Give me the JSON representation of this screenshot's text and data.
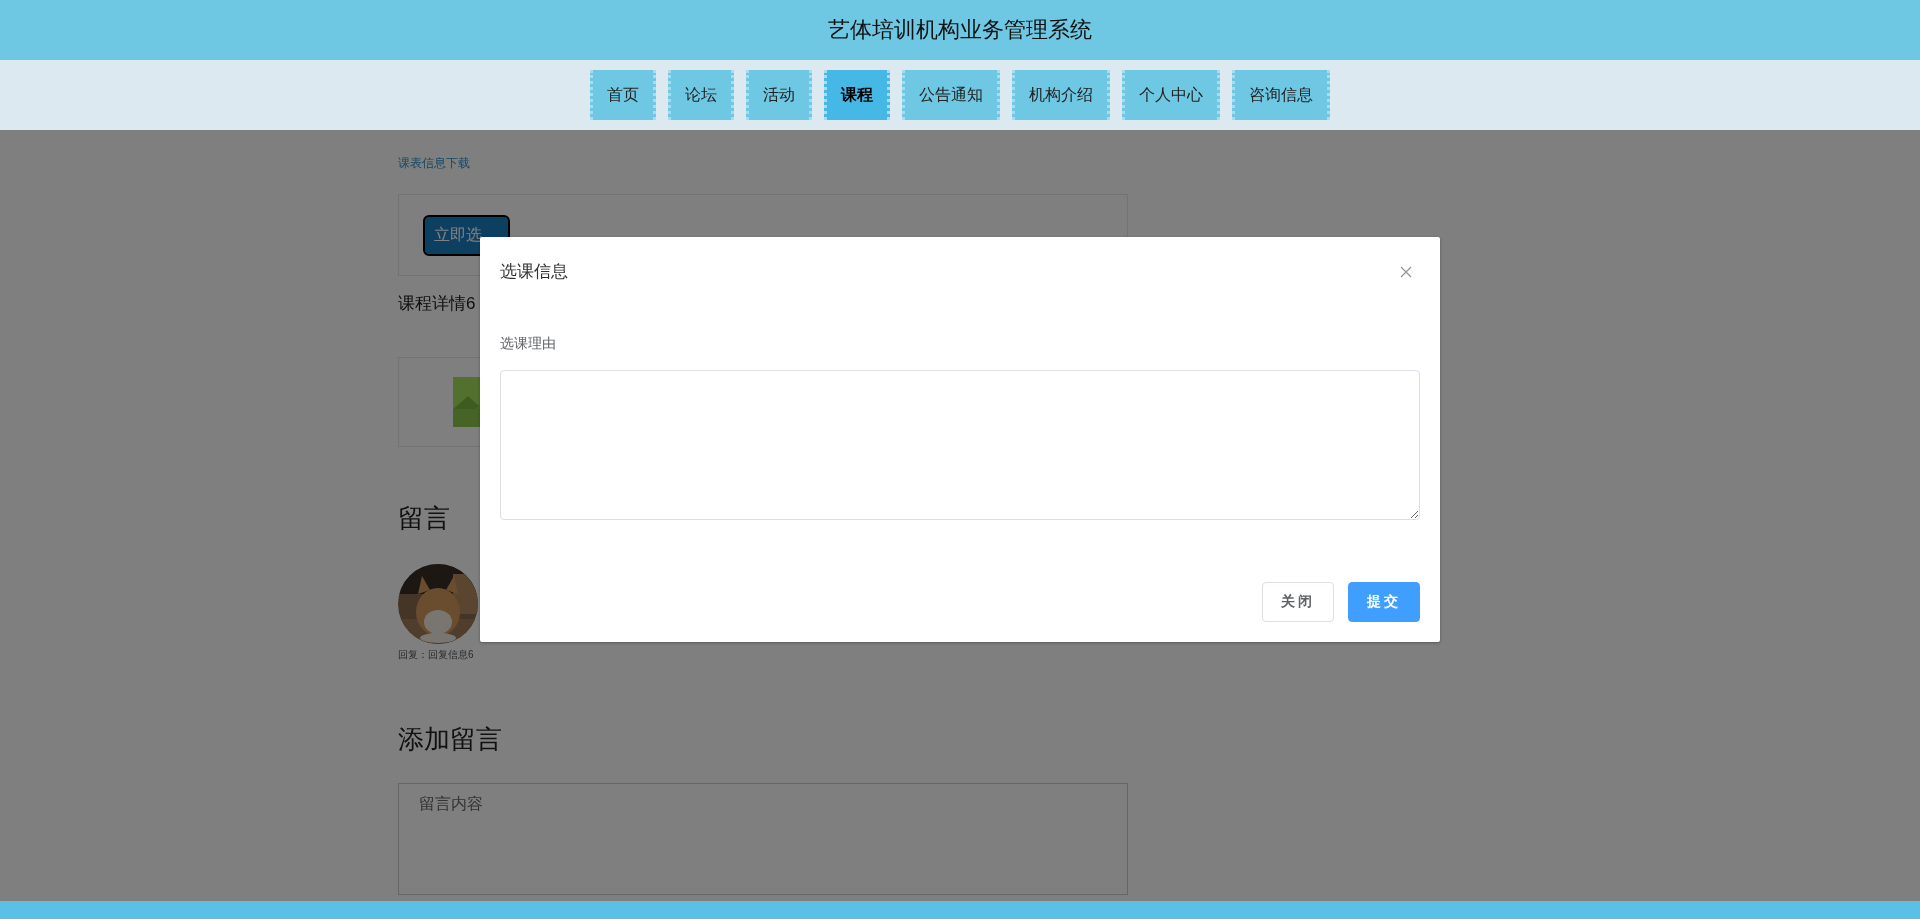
{
  "header": {
    "title": "艺体培训机构业务管理系统"
  },
  "nav": [
    {
      "label": "首页",
      "selected": false
    },
    {
      "label": "论坛",
      "selected": false
    },
    {
      "label": "活动",
      "selected": false
    },
    {
      "label": "课程",
      "selected": true
    },
    {
      "label": "公告通知",
      "selected": false
    },
    {
      "label": "机构介绍",
      "selected": false
    },
    {
      "label": "个人中心",
      "selected": false
    },
    {
      "label": "咨询信息",
      "selected": false
    }
  ],
  "content": {
    "download_link": "课表信息下载",
    "select_button": "立即选",
    "detail_title": "课程详情6",
    "comments_heading": "留言",
    "comments": [
      {
        "reply": "回复：回复信息6"
      }
    ],
    "add_heading": "添加留言",
    "comment_field": {
      "placeholder": "留言内容"
    }
  },
  "dialog": {
    "title": "选课信息",
    "field_label": "选课理由",
    "buttons": [
      {
        "label": "关闭",
        "kind": "default"
      },
      {
        "label": "提交",
        "kind": "primary"
      }
    ]
  }
}
